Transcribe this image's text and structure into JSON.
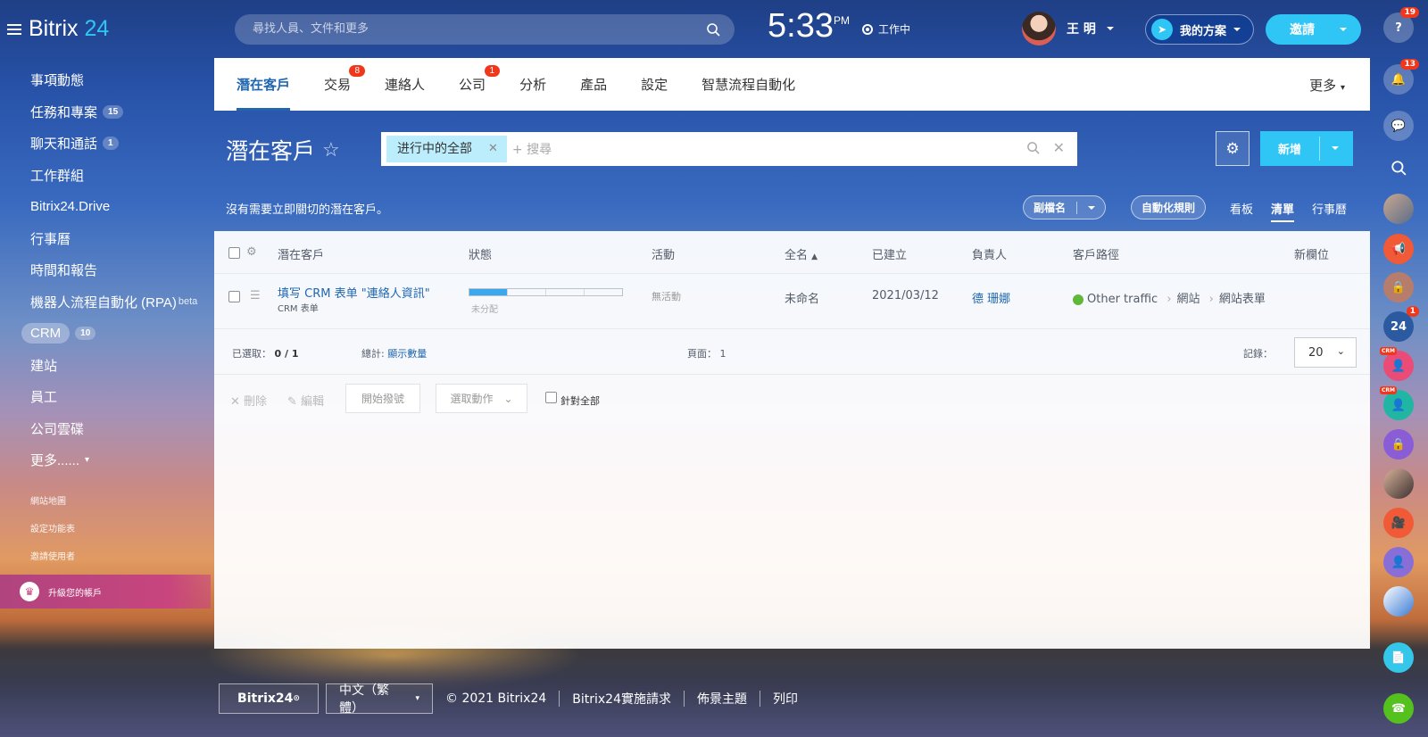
{
  "app": {
    "logo_name": "Bitrix",
    "logo_num": "24"
  },
  "header": {
    "search_placeholder": "尋找人員、文件和更多",
    "time": "5:33",
    "ampm": "PM",
    "work_status": "工作中",
    "user_name": "王 明",
    "my_plan": "我的方案",
    "invite": "邀請"
  },
  "sidebar": {
    "items": [
      {
        "label": "事項動態"
      },
      {
        "label": "任務和專案",
        "badge": "15"
      },
      {
        "label": "聊天和通話",
        "badge": "1"
      },
      {
        "label": "工作群組"
      },
      {
        "label": "Bitrix24.Drive"
      },
      {
        "label": "行事曆"
      },
      {
        "label": "時間和報告"
      },
      {
        "label": "機器人流程自動化 (RPA)",
        "sup": "beta"
      },
      {
        "label": "CRM",
        "badge": "10"
      },
      {
        "label": "建站"
      },
      {
        "label": "員工"
      },
      {
        "label": "公司雲碟"
      },
      {
        "label": "更多......"
      }
    ],
    "small_links": [
      "網站地圖",
      "設定功能表",
      "邀請使用者"
    ],
    "upgrade": "升級您的帳戶"
  },
  "tabs": [
    {
      "label": "潛在客戶"
    },
    {
      "label": "交易",
      "count": "8"
    },
    {
      "label": "連絡人"
    },
    {
      "label": "公司",
      "count": "1"
    },
    {
      "label": "分析"
    },
    {
      "label": "產品"
    },
    {
      "label": "設定"
    },
    {
      "label": "智慧流程自動化"
    }
  ],
  "more_tab": "更多",
  "page": {
    "title": "潛在客戶",
    "filter_tag": "进行中的全部",
    "filter_placeholder": "+ 搜尋",
    "new_button": "新增",
    "hint": "沒有需要立即關切的潛在客戶。",
    "alias_button": "副檔名",
    "automation_button": "自動化規則",
    "views": [
      "看板",
      "清單",
      "行事曆"
    ]
  },
  "grid": {
    "columns": [
      "潛在客戶",
      "狀態",
      "活動",
      "全名",
      "已建立",
      "負責人",
      "客戶路徑",
      "新欄位"
    ],
    "rows": [
      {
        "name": "填写 CRM 表单 \"連絡人資訊\"",
        "sub": "CRM 表单",
        "status_label": "未分配",
        "status_progress": 0.25,
        "activity": "無活動",
        "fullname": "未命名",
        "created": "2021/03/12",
        "owner": "德 珊娜",
        "path": [
          "Other traffic",
          "網站",
          "網站表單"
        ]
      }
    ],
    "footer": {
      "selected_label": "已選取：",
      "selected_value": "0 / 1",
      "total_label": "總計:",
      "total_link": "顯示數量",
      "page_label": "頁面：",
      "page_value": "1",
      "records_label": "記錄：",
      "records_value": "20"
    },
    "actions": {
      "delete": "刪除",
      "edit": "編輯",
      "start_dial": "開始撥號",
      "select_action": "選取動作",
      "for_all": "針對全部"
    }
  },
  "right_bar": {
    "help_badge": "19",
    "notify_badge": "13",
    "b24_badge": "1",
    "crm_label": "CRM"
  },
  "footer": {
    "brand": "Bitrix24",
    "language": "中文（繁體）",
    "copyright": "© 2021 Bitrix24",
    "impl": "Bitrix24實施請求",
    "theme": "佈景主題",
    "print": "列印"
  },
  "colors": {
    "accent": "#2fc6f6",
    "link": "#2067b0",
    "badge": "#f0371b",
    "upgrade": "#c8457e"
  }
}
